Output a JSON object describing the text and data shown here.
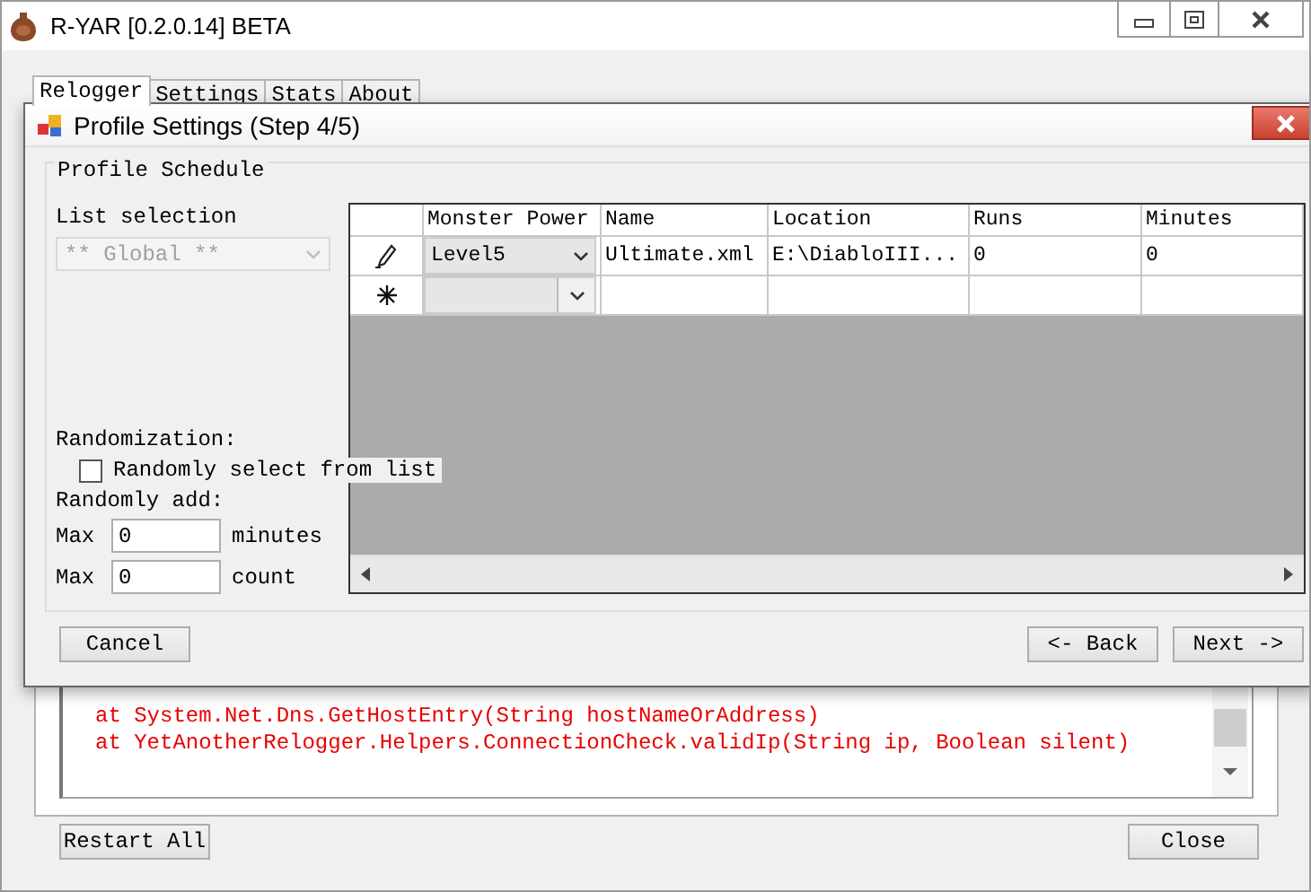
{
  "window": {
    "title": "R-YAR [0.2.0.14] BETA"
  },
  "tabs": [
    {
      "label": "Relogger",
      "selected": true
    },
    {
      "label": "Settings",
      "selected": false
    },
    {
      "label": "Stats",
      "selected": false
    },
    {
      "label": "About",
      "selected": false
    }
  ],
  "log": {
    "lines": [
      "at System.Net.Dns.GetHostEntry(String hostNameOrAddress)",
      "at YetAnotherRelogger.Helpers.ConnectionCheck.validIp(String ip, Boolean silent)"
    ]
  },
  "buttons": [
    "Restart All",
    "Close"
  ],
  "dialog": {
    "title": "Profile Settings (Step 4/5)",
    "group_title": "Profile Schedule",
    "list_selection": {
      "label": "List selection",
      "value": "** Global **",
      "disabled": true
    },
    "table": {
      "columns": [
        "Monster Power",
        "Name",
        "Location",
        "Runs",
        "Minutes"
      ],
      "rows": [
        {
          "kind": "edit",
          "monster_power": "Level5",
          "cells": [
            "Ultimate.xml",
            "E:\\DiabloIII...",
            "0",
            "0"
          ]
        },
        {
          "kind": "new"
        }
      ]
    },
    "randomization": {
      "label": "Randomization:",
      "checkbox": {
        "label": "Randomly select from list",
        "checked": false
      },
      "add_label": "Randomly add:",
      "fields": [
        {
          "label": "Max",
          "value": "0",
          "unit": "minutes"
        },
        {
          "label": "Max",
          "value": "0",
          "unit": "count"
        }
      ]
    },
    "buttons": [
      {
        "label": "Cancel"
      },
      {
        "label": "<- Back"
      },
      {
        "label": "Next ->"
      }
    ]
  }
}
